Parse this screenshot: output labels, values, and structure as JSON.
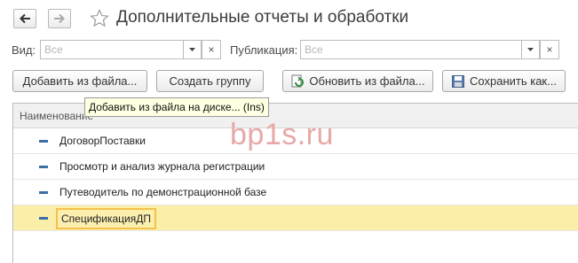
{
  "window": {
    "title": "Дополнительные отчеты и обработки"
  },
  "nav": {
    "back_icon": "arrow-left-icon",
    "forward_icon": "arrow-right-icon",
    "favorite_icon": "star-icon"
  },
  "filters": {
    "vid_label": "Вид:",
    "vid_placeholder": "Все",
    "pub_label": "Публикация:",
    "pub_placeholder": "Все"
  },
  "toolbar": {
    "add_from_file": "Добавить из файла...",
    "create_group": "Создать группу",
    "update_from_file": "Обновить из файла...",
    "save_as": "Сохранить как..."
  },
  "tooltip": "Добавить из файла на диске... (Ins)",
  "table": {
    "header": "Наименование",
    "rows": [
      "ДоговорПоставки",
      "Просмотр и анализ журнала регистрации",
      "Путеводитель по демонстрационной базе",
      "СпецификацияДП"
    ]
  },
  "watermark": "bp1s.ru",
  "colors": {
    "selected_row": "#fbeea9",
    "selected_border": "#f4c14c",
    "row_marker": "#3a6ea5",
    "tooltip_bg": "#ffffe1"
  }
}
